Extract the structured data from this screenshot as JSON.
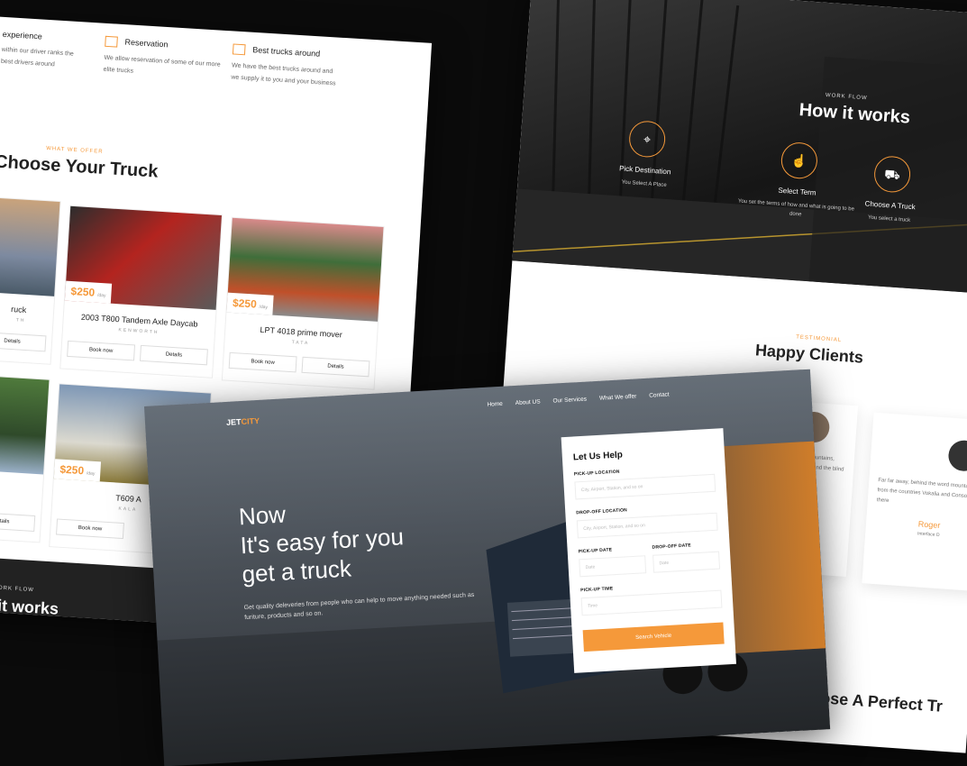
{
  "left": {
    "features": [
      {
        "title": "experience",
        "desc": "within our driver ranks the best drivers around"
      },
      {
        "title": "Reservation",
        "desc": "We allow reservation of some of our more elite trucks"
      },
      {
        "title": "Best trucks around",
        "desc": "We have the best trucks around and we supply it to you and your business"
      }
    ],
    "offer_tag": "WHAT WE OFFER",
    "offer_title": "Choose Your Truck",
    "trucks": [
      {
        "price": "",
        "per": "",
        "name": "ruck",
        "brand": "TH",
        "book": "",
        "details": "Details"
      },
      {
        "price": "$250",
        "per": "/day",
        "name": "2003 T800 Tandem Axle Daycab",
        "brand": "KENWORTH",
        "book": "Book now",
        "details": "Details"
      },
      {
        "price": "$250",
        "per": "/day",
        "name": "LPT 4018 prime mover",
        "brand": "TATA",
        "book": "Book now",
        "details": "Details"
      },
      {
        "price": "",
        "per": "",
        "name": "",
        "brand": "",
        "book": "",
        "details": "Details"
      },
      {
        "price": "$250",
        "per": "/day",
        "name": "T609 A",
        "brand": "KALA",
        "book": "Book now",
        "details": ""
      }
    ],
    "how_tag": "WORK FLOW",
    "how_title": "How it works"
  },
  "right": {
    "tag": "WORK FLOW",
    "title": "How it works",
    "steps": [
      {
        "title": "Pick Destination",
        "desc": "You Select A Place"
      },
      {
        "title": "Select Term",
        "desc": "You set the terms of how and what is going to be done"
      },
      {
        "title": "Choose A Truck",
        "desc": "You select a truck"
      }
    ],
    "testimonial_tag": "TESTIMONIAL",
    "testimonial_title": "Happy Clients",
    "clients": [
      {
        "text": "word mountains, Vokalia and the blind texts.",
        "name": ""
      },
      {
        "text": "Far far away, behind the word mountains, far from the countries Vokalia and Consonantia, there",
        "name": "Roger",
        "role": "Interface D"
      }
    ],
    "bottom_title": "Choose A Perfect Tr"
  },
  "front": {
    "logo_a": "JET",
    "logo_b": "CITY",
    "nav": [
      "Home",
      "About US",
      "Our Services",
      "What We offer",
      "Contact"
    ],
    "headline": [
      "Now",
      "It's easy for you",
      "get a truck"
    ],
    "sub": "Get quality deleveries from people who can help to move anything needed such as furiture, products and so on.",
    "form": {
      "title": "Let Us Help",
      "pickup_label": "PICK-UP LOCATION",
      "pickup_ph": "City, Airport, Station, and so on",
      "dropoff_label": "DROP-OFF LOCATION",
      "dropoff_ph": "City, Airport, Station, and so on",
      "pickup_date_label": "PICK-UP DATE",
      "dropoff_date_label": "DROP-OFF DATE",
      "date_ph": "Date",
      "time_label": "PICK-UP TIME",
      "time_ph": "Time",
      "submit": "Search Vehicle"
    }
  },
  "colors": {
    "accent": "#f5993a"
  }
}
